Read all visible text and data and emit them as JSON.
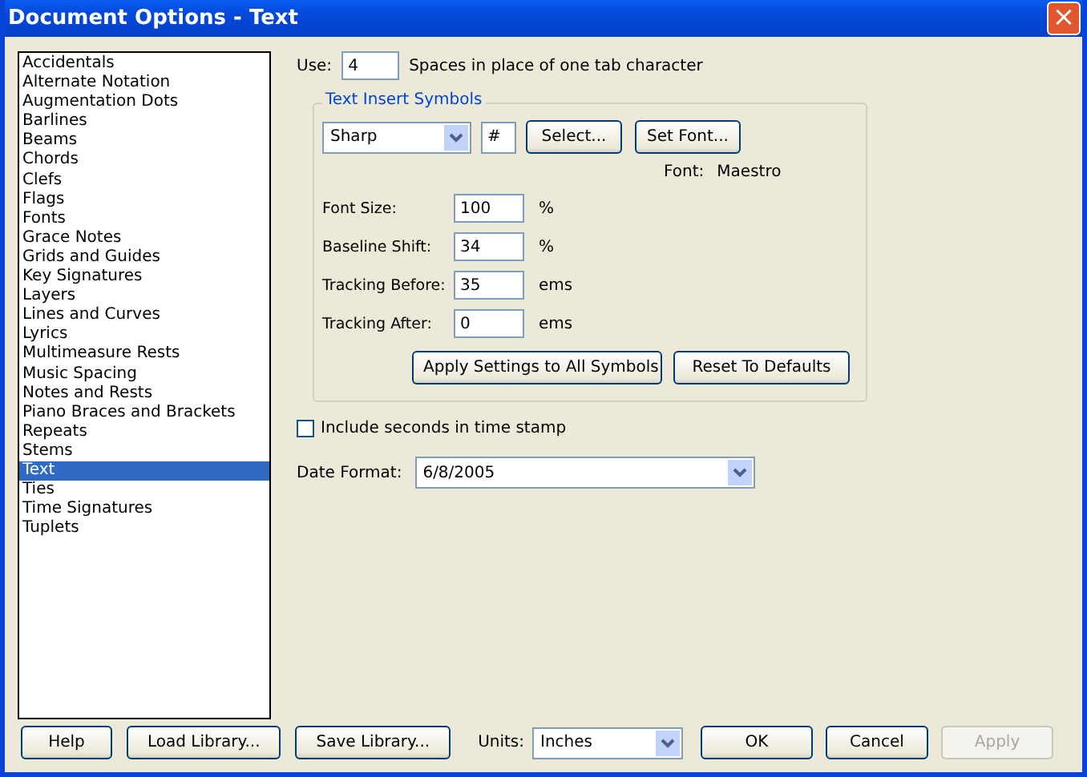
{
  "window": {
    "title": "Document Options - Text",
    "close_label": "×"
  },
  "categories": [
    {
      "label": "Accidentals",
      "selected": false
    },
    {
      "label": "Alternate Notation",
      "selected": false
    },
    {
      "label": "Augmentation Dots",
      "selected": false
    },
    {
      "label": "Barlines",
      "selected": false
    },
    {
      "label": "Beams",
      "selected": false
    },
    {
      "label": "Chords",
      "selected": false
    },
    {
      "label": "Clefs",
      "selected": false
    },
    {
      "label": "Flags",
      "selected": false
    },
    {
      "label": "Fonts",
      "selected": false
    },
    {
      "label": "Grace Notes",
      "selected": false
    },
    {
      "label": "Grids and Guides",
      "selected": false
    },
    {
      "label": "Key Signatures",
      "selected": false
    },
    {
      "label": "Layers",
      "selected": false
    },
    {
      "label": "Lines and Curves",
      "selected": false
    },
    {
      "label": "Lyrics",
      "selected": false
    },
    {
      "label": "Multimeasure Rests",
      "selected": false
    },
    {
      "label": "Music Spacing",
      "selected": false
    },
    {
      "label": "Notes and Rests",
      "selected": false
    },
    {
      "label": "Piano Braces and Brackets",
      "selected": false
    },
    {
      "label": "Repeats",
      "selected": false
    },
    {
      "label": "Stems",
      "selected": false
    },
    {
      "label": "Text",
      "selected": true
    },
    {
      "label": "Ties",
      "selected": false
    },
    {
      "label": "Time Signatures",
      "selected": false
    },
    {
      "label": "Tuplets",
      "selected": false
    }
  ],
  "use": {
    "label": "Use:",
    "value": "4",
    "suffix": "Spaces in place of one tab character"
  },
  "text_insert_symbols": {
    "title": "Text Insert Symbols",
    "symbol": "Sharp",
    "character": "#",
    "buttons": [
      {
        "label": "Select..."
      },
      {
        "label": "Set Font..."
      }
    ],
    "font_label": "Font:",
    "font_value": "Maestro",
    "fields": [
      {
        "label": "Font Size:",
        "value": "100",
        "unit": "%"
      },
      {
        "label": "Baseline Shift:",
        "value": "34",
        "unit": "%"
      },
      {
        "label": "Tracking Before:",
        "value": "35",
        "unit": "ems"
      },
      {
        "label": "Tracking After:",
        "value": "0",
        "unit": "ems"
      }
    ],
    "actions": [
      {
        "label": "Apply Settings to All Symbols"
      },
      {
        "label": "Reset To Defaults"
      }
    ]
  },
  "include_seconds": {
    "label": "Include seconds in time stamp",
    "checked": false
  },
  "date_format": {
    "label": "Date Format:",
    "value": "6/8/2005"
  },
  "footer": {
    "buttons_left": [
      {
        "label": "Help",
        "disabled": false
      },
      {
        "label": "Load Library...",
        "disabled": false
      },
      {
        "label": "Save Library...",
        "disabled": false
      }
    ],
    "units_label": "Units:",
    "units_value": "Inches",
    "buttons_right": [
      {
        "label": "OK",
        "disabled": false
      },
      {
        "label": "Cancel",
        "disabled": false
      },
      {
        "label": "Apply",
        "disabled": true
      }
    ]
  }
}
